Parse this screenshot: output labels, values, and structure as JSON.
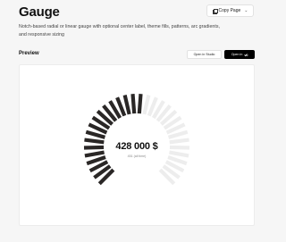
{
  "header": {
    "title": "Gauge",
    "copy_page_label": "Copy Page",
    "description": "Notch-based radial or linear gauge with optional center label, theme fills, patterns, arc gradients, and responsive sizing"
  },
  "preview": {
    "label": "Preview",
    "open_in_studio_label": "Open in Studio",
    "open_in_label": "Open in",
    "v0_label": "v0"
  },
  "gauge": {
    "value_text": "428 000 $",
    "sub_text": "451 (all time)",
    "filled_fraction": 0.54,
    "notch_count": 32,
    "filled_color": "#2a2726",
    "empty_color": "#ededed"
  }
}
